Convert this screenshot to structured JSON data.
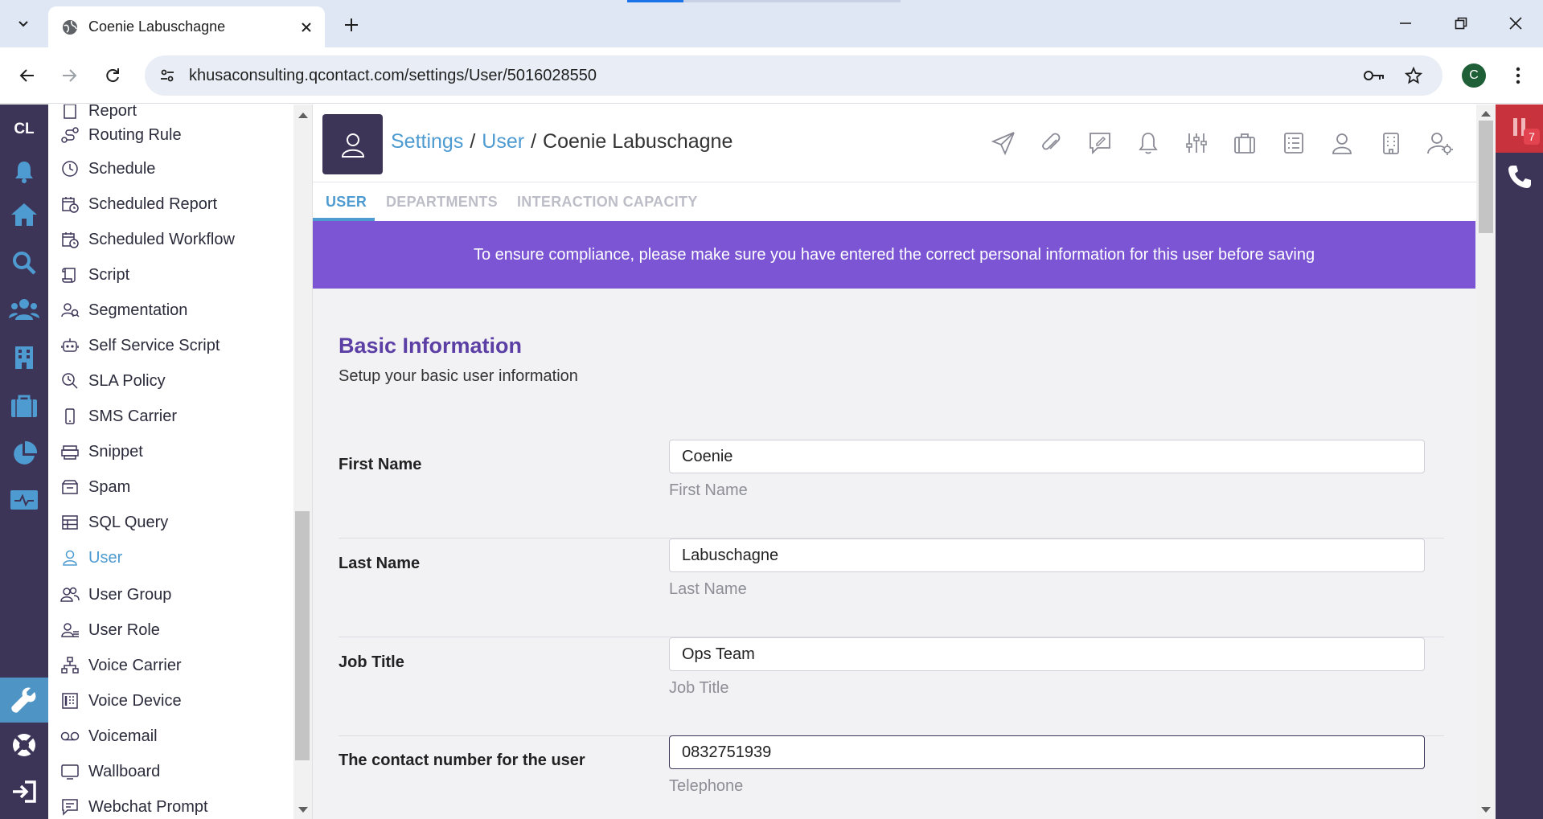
{
  "browser": {
    "tab_title": "Coenie Labuschagne",
    "url": "khusaconsulting.qcontact.com/settings/User/5016028550",
    "profile_initial": "C"
  },
  "rail": {
    "initials": "CL"
  },
  "nav": {
    "items": [
      {
        "label": "Report",
        "icon": "report-icon"
      },
      {
        "label": "Routing Rule",
        "icon": "routing-icon"
      },
      {
        "label": "Schedule",
        "icon": "clock-icon"
      },
      {
        "label": "Scheduled Report",
        "icon": "calendar-clock-icon"
      },
      {
        "label": "Scheduled Workflow",
        "icon": "calendar-clock-icon"
      },
      {
        "label": "Script",
        "icon": "script-icon"
      },
      {
        "label": "Segmentation",
        "icon": "segmentation-icon"
      },
      {
        "label": "Self Service Script",
        "icon": "robot-icon"
      },
      {
        "label": "SLA Policy",
        "icon": "sla-icon"
      },
      {
        "label": "SMS Carrier",
        "icon": "mobile-icon"
      },
      {
        "label": "Snippet",
        "icon": "snippet-icon"
      },
      {
        "label": "Spam",
        "icon": "spam-icon"
      },
      {
        "label": "SQL Query",
        "icon": "table-icon"
      },
      {
        "label": "User",
        "icon": "user-icon"
      },
      {
        "label": "User Group",
        "icon": "users-icon"
      },
      {
        "label": "User Role",
        "icon": "user-role-icon"
      },
      {
        "label": "Voice Carrier",
        "icon": "network-icon"
      },
      {
        "label": "Voice Device",
        "icon": "phone-device-icon"
      },
      {
        "label": "Voicemail",
        "icon": "voicemail-icon"
      },
      {
        "label": "Wallboard",
        "icon": "monitor-icon"
      },
      {
        "label": "Webchat Prompt",
        "icon": "chat-prompt-icon"
      }
    ],
    "active": "User"
  },
  "header": {
    "breadcrumb": {
      "settings": "Settings",
      "sep1": "/",
      "user": "User",
      "sep2": "/",
      "current": "Coenie Labuschagne"
    }
  },
  "tabs": [
    "USER",
    "DEPARTMENTS",
    "INTERACTION CAPACITY"
  ],
  "banner": "To ensure compliance, please make sure you have entered the correct personal information for this user before saving",
  "section": {
    "title": "Basic Information",
    "subtitle": "Setup your basic user information"
  },
  "fields": [
    {
      "label": "First Name",
      "value": "Coenie",
      "help": "First Name"
    },
    {
      "label": "Last Name",
      "value": "Labuschagne",
      "help": "Last Name"
    },
    {
      "label": "Job Title",
      "value": "Ops Team",
      "help": "Job Title"
    },
    {
      "label": "The contact number for the user",
      "value": "0832751939",
      "help": "Telephone"
    }
  ],
  "right_rail": {
    "pause_count": "7"
  },
  "colors": {
    "rail": "#3d3558",
    "accent": "#4e9bd1",
    "banner": "#7b55d4",
    "section_title": "#5b3fa5",
    "pause": "#c8323c"
  }
}
